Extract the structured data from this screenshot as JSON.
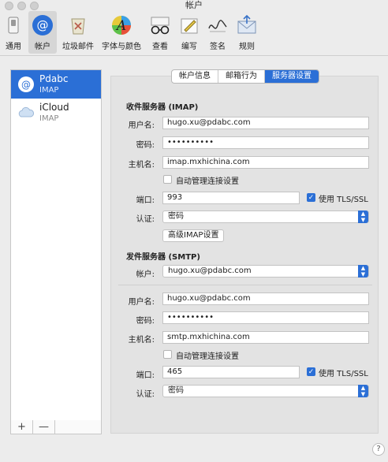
{
  "window": {
    "title": "帐户"
  },
  "toolbar": {
    "items": [
      {
        "label": "通用",
        "icon": "general-switch-icon"
      },
      {
        "label": "帐户",
        "icon": "at-sign-icon",
        "active": true
      },
      {
        "label": "垃圾邮件",
        "icon": "junk-mail-icon"
      },
      {
        "label": "字体与颜色",
        "icon": "fonts-colors-icon"
      },
      {
        "label": "查看",
        "icon": "glasses-icon"
      },
      {
        "label": "编写",
        "icon": "compose-pencil-icon"
      },
      {
        "label": "签名",
        "icon": "signature-icon"
      },
      {
        "label": "规则",
        "icon": "rules-envelope-icon"
      }
    ]
  },
  "sidebar": {
    "accounts": [
      {
        "name": "Pdabc",
        "type": "IMAP",
        "icon": "at-sign-icon"
      },
      {
        "name": "iCloud",
        "type": "IMAP",
        "icon": "cloud-icon"
      }
    ],
    "add_label": "+",
    "remove_label": "—"
  },
  "tabs": [
    "帐户信息",
    "邮箱行为",
    "服务器设置"
  ],
  "incoming": {
    "section_title": "收件服务器 (IMAP)",
    "username_label": "用户名:",
    "username": "hugo.xu@pdabc.com",
    "password_label": "密码:",
    "password": "••••••••••",
    "host_label": "主机名:",
    "host": "imap.mxhichina.com",
    "auto_manage_label": "自动管理连接设置",
    "port_label": "端口:",
    "port": "993",
    "tls_label": "使用 TLS/SSL",
    "auth_label": "认证:",
    "auth": "密码",
    "advanced_button": "高级IMAP设置"
  },
  "outgoing": {
    "section_title": "发件服务器 (SMTP)",
    "account_label": "帐户:",
    "account": "hugo.xu@pdabc.com",
    "username_label": "用户名:",
    "username": "hugo.xu@pdabc.com",
    "password_label": "密码:",
    "password": "••••••••••",
    "host_label": "主机名:",
    "host": "smtp.mxhichina.com",
    "auto_manage_label": "自动管理连接设置",
    "port_label": "端口:",
    "port": "465",
    "tls_label": "使用 TLS/SSL",
    "auth_label": "认证:",
    "auth": "密码"
  },
  "help_label": "?",
  "colors": {
    "accent": "#2b6fd6"
  }
}
